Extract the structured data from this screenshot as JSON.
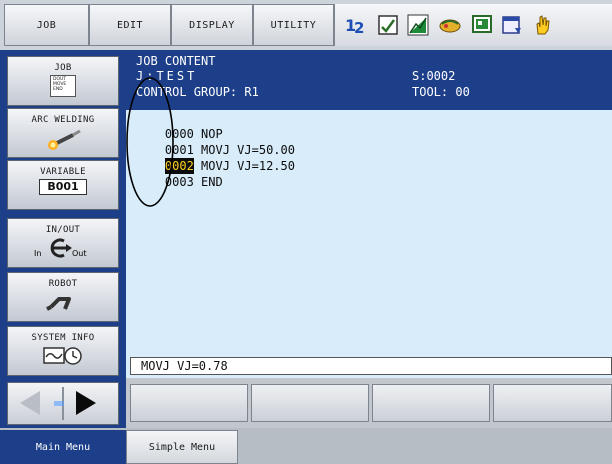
{
  "top_menu": {
    "items": [
      {
        "label": "JOB"
      },
      {
        "label": "EDIT"
      },
      {
        "label": "DISPLAY"
      },
      {
        "label": "UTILITY"
      }
    ],
    "icons": [
      "servo-number-icon",
      "page-icon",
      "chart-icon",
      "handshake-icon",
      "monitor-icon",
      "window-icon",
      "hand-icon"
    ]
  },
  "sidebar": {
    "items": [
      {
        "label": "JOB",
        "doc_lines": [
          "DOUT",
          "MOVE",
          "END"
        ]
      },
      {
        "label": "ARC WELDING"
      },
      {
        "label": "VARIABLE",
        "value": "B001"
      },
      {
        "label": "IN/OUT",
        "in": "In",
        "out": "Out"
      },
      {
        "label": "ROBOT"
      },
      {
        "label": "SYSTEM INFO"
      }
    ]
  },
  "job_content": {
    "heading": "JOB CONTENT",
    "job_name": "J:TEST",
    "step": "S:0002",
    "control_group": "CONTROL GROUP: R1",
    "tool": "TOOL: 00",
    "lines": [
      {
        "num": "0000",
        "text": "NOP",
        "selected": false
      },
      {
        "num": "0001",
        "text": "MOVJ VJ=50.00",
        "selected": false
      },
      {
        "num": "0002",
        "text": "MOVJ VJ=12.50",
        "selected": true
      },
      {
        "num": "0003",
        "text": "END",
        "selected": false
      }
    ]
  },
  "input_line": {
    "value": "MOVJ VJ=0.78"
  },
  "bottom_tabs": {
    "main_menu": "Main Menu",
    "simple_menu": "Simple Menu"
  },
  "colors": {
    "header_bg": "#1d3f8a",
    "content_bg": "#d8ecfa",
    "selected_line_fg": "#ffd21a",
    "selected_line_bg": "#0b0b0b"
  }
}
